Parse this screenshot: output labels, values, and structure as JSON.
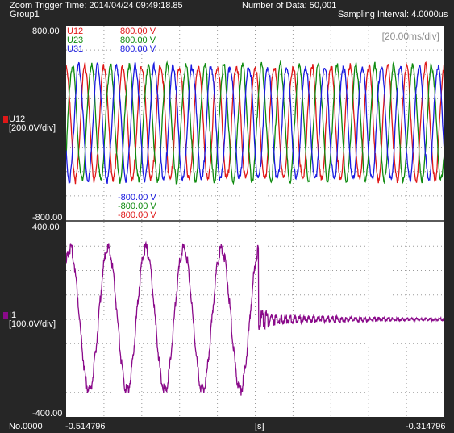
{
  "header": {
    "trigger_time": "Zoom Trigger Time: 2014/04/24 09:49:18.85",
    "group": "Group1",
    "data_count": "Number of Data: 50,001",
    "sampling": "Sampling Interval:  4.0000us"
  },
  "upper": {
    "ymax_label": "800.00",
    "ymin_label": "-800.00",
    "channel_name": "U12",
    "channel_scale": "[200.0V/div]",
    "time_div": "[20.00ms/div]",
    "legend": [
      {
        "name": "U12",
        "max": "800.00 V",
        "min": "-800.00 V",
        "color": "#e01818"
      },
      {
        "name": "U23",
        "max": "800.00 V",
        "min": "-800.00 V",
        "color": "#0e8a0e"
      },
      {
        "name": "U31",
        "max": "800.00 V",
        "min": "-800.00 V",
        "color": "#1a1ae0"
      }
    ]
  },
  "lower": {
    "ymax_label": "400.00",
    "ymin_label": "-400.00",
    "channel_name": "I1",
    "channel_scale": "[100.0V/div]",
    "color": "#8a0a8a"
  },
  "footer": {
    "number": "No.0000",
    "x_start": "-0.514796",
    "x_unit": "[s]",
    "x_end": "-0.314796"
  },
  "chart_data": [
    {
      "type": "line",
      "xlim": [
        -0.514796,
        -0.314796
      ],
      "ylim": [
        -800,
        800
      ],
      "grid": true,
      "series": [
        {
          "name": "U12",
          "amplitude": 470,
          "frequency_hz": 100,
          "phase_deg": 90
        },
        {
          "name": "U23",
          "amplitude": 470,
          "frequency_hz": 100,
          "phase_deg": -30
        },
        {
          "name": "U31",
          "amplitude": 470,
          "frequency_hz": 100,
          "phase_deg": 210
        }
      ]
    },
    {
      "type": "line",
      "xlim": [
        -0.514796,
        -0.314796
      ],
      "ylim": [
        -400,
        400
      ],
      "grid": true,
      "series": [
        {
          "name": "I1",
          "amplitude": 290,
          "frequency_hz": 50,
          "phase_deg": 0,
          "interrupt_at_s": -0.413,
          "residual_amplitude": 15
        }
      ]
    }
  ]
}
